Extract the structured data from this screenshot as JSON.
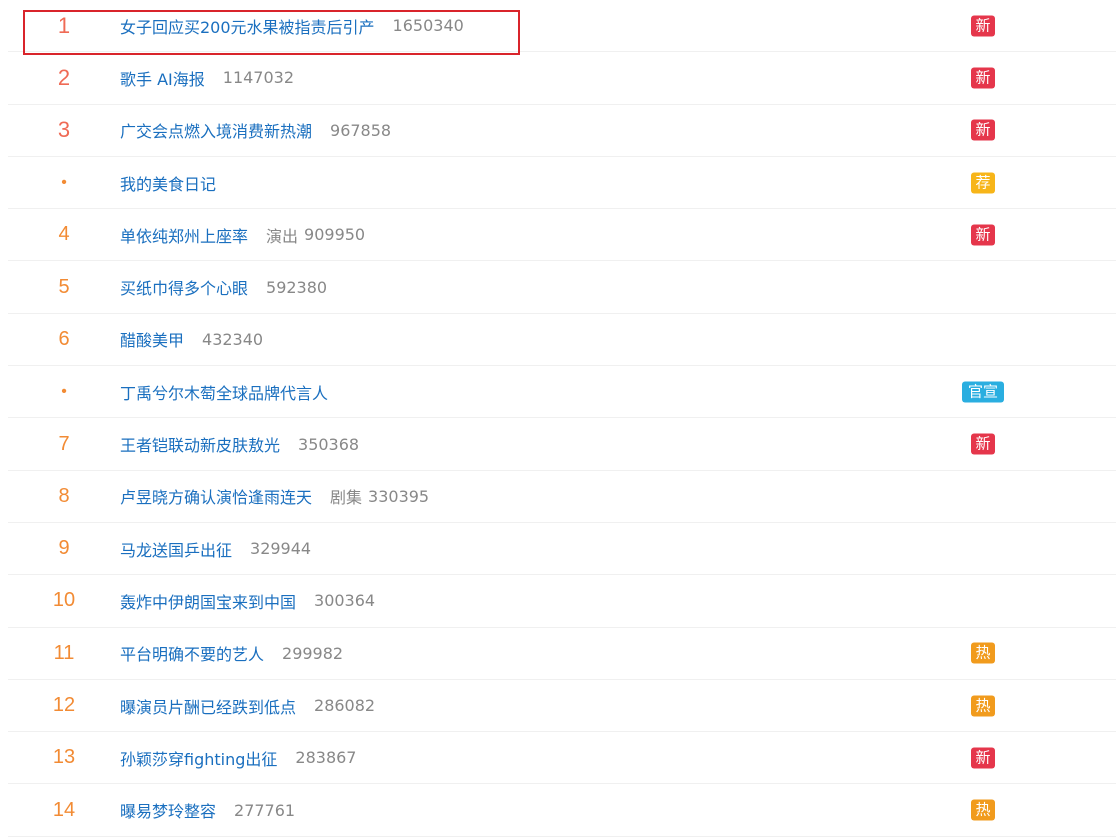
{
  "hot_search_list": [
    {
      "rank": "1",
      "title": "女子回应买200元水果被指责后引产",
      "category": "",
      "heat": "1650340",
      "badge": "新",
      "badge_color": "#e5364b",
      "rank_color": "#ef6a55"
    },
    {
      "rank": "2",
      "title": "歌手 AI海报",
      "category": "",
      "heat": "1147032",
      "badge": "新",
      "badge_color": "#e5364b",
      "rank_color": "#ef6a55"
    },
    {
      "rank": "3",
      "title": "广交会点燃入境消费新热潮",
      "category": "",
      "heat": "967858",
      "badge": "新",
      "badge_color": "#e5364b",
      "rank_color": "#ef6a55"
    },
    {
      "rank": "•",
      "title": "我的美食日记",
      "category": "",
      "heat": "",
      "badge": "荐",
      "badge_color": "#f7b519",
      "rank_color": "#f28b34"
    },
    {
      "rank": "4",
      "title": "单依纯郑州上座率",
      "category": "演出",
      "heat": "909950",
      "badge": "新",
      "badge_color": "#e5364b",
      "rank_color": "#f28b34"
    },
    {
      "rank": "5",
      "title": "买纸巾得多个心眼",
      "category": "",
      "heat": "592380",
      "badge": "",
      "badge_color": "",
      "rank_color": "#f28b34"
    },
    {
      "rank": "6",
      "title": "醋酸美甲",
      "category": "",
      "heat": "432340",
      "badge": "",
      "badge_color": "",
      "rank_color": "#f28b34"
    },
    {
      "rank": "•",
      "title": "丁禹兮尔木萄全球品牌代言人",
      "category": "",
      "heat": "",
      "badge": "官宣",
      "badge_color": "#2aaee0",
      "rank_color": "#f28b34"
    },
    {
      "rank": "7",
      "title": "王者铠联动新皮肤敖光",
      "category": "",
      "heat": "350368",
      "badge": "新",
      "badge_color": "#e5364b",
      "rank_color": "#f28b34"
    },
    {
      "rank": "8",
      "title": "卢昱晓方确认演恰逢雨连天",
      "category": "剧集",
      "heat": "330395",
      "badge": "",
      "badge_color": "",
      "rank_color": "#f28b34"
    },
    {
      "rank": "9",
      "title": "马龙送国乒出征",
      "category": "",
      "heat": "329944",
      "badge": "",
      "badge_color": "",
      "rank_color": "#f28b34"
    },
    {
      "rank": "10",
      "title": "轰炸中伊朗国宝来到中国",
      "category": "",
      "heat": "300364",
      "badge": "",
      "badge_color": "",
      "rank_color": "#f28b34"
    },
    {
      "rank": "11",
      "title": "平台明确不要的艺人",
      "category": "",
      "heat": "299982",
      "badge": "热",
      "badge_color": "#f19b1d",
      "rank_color": "#f28b34"
    },
    {
      "rank": "12",
      "title": "曝演员片酬已经跌到低点",
      "category": "",
      "heat": "286082",
      "badge": "热",
      "badge_color": "#f19b1d",
      "rank_color": "#f28b34"
    },
    {
      "rank": "13",
      "title": "孙颖莎穿fighting出征",
      "category": "",
      "heat": "283867",
      "badge": "新",
      "badge_color": "#e5364b",
      "rank_color": "#f28b34"
    },
    {
      "rank": "14",
      "title": "曝易梦玲整容",
      "category": "",
      "heat": "277761",
      "badge": "热",
      "badge_color": "#f19b1d",
      "rank_color": "#f28b34"
    }
  ],
  "colors": {
    "title_link": "#1a6fbf",
    "meta_text": "#888888",
    "highlight_border": "#d9242b"
  }
}
